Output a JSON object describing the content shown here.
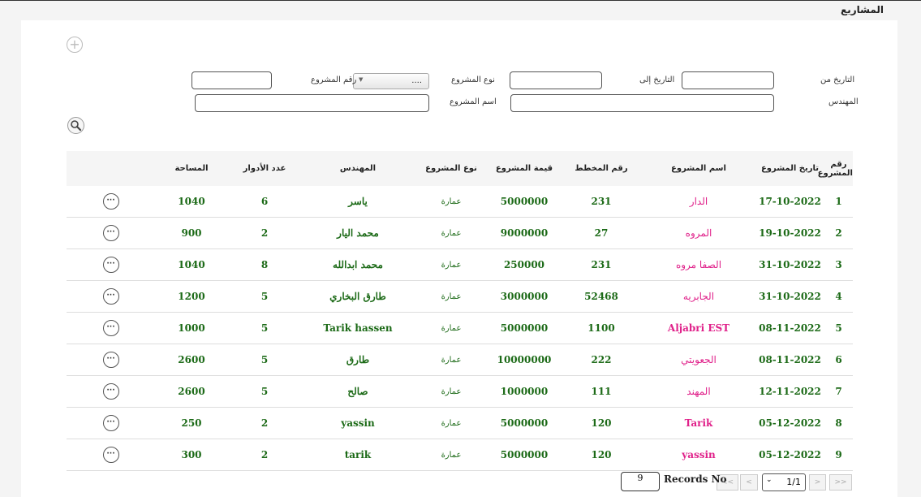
{
  "page_title": "المشاريع",
  "add_icon": "plus-circle-icon",
  "filters": {
    "date_from_label": "التاريخ من",
    "date_to_label": "التاريخ إلى",
    "project_type_label": "نوع المشروع",
    "project_number_label": "رقم المشروع",
    "project_number_value": "....",
    "engineer_label": "المهندس",
    "project_name_label": "اسم المشروع",
    "search_icon": "magnifier-icon"
  },
  "table": {
    "headers": [
      "رقم المشروع",
      "تاريخ المشروع",
      "اسم المشروع",
      "رقم المخطط",
      "قيمة المشروع",
      "نوع المشروع",
      "المهندس",
      "عدد الأدوار",
      "المساحة",
      ""
    ],
    "rows": [
      {
        "no": "1",
        "date": "17-10-2022",
        "name": "الدار",
        "plan": "231",
        "value": "5000000",
        "type": "عمارة",
        "engineer": "ياسر",
        "floors": "6",
        "area": "1040"
      },
      {
        "no": "2",
        "date": "19-10-2022",
        "name": "المروه",
        "plan": "27",
        "value": "9000000",
        "type": "عمارة",
        "engineer": "محمد اليار",
        "floors": "2",
        "area": "900"
      },
      {
        "no": "3",
        "date": "31-10-2022",
        "name": "الصفا مروه",
        "plan": "231",
        "value": "250000",
        "type": "عمارة",
        "engineer": "محمد ابدالله",
        "floors": "8",
        "area": "1040"
      },
      {
        "no": "4",
        "date": "31-10-2022",
        "name": "الجابريه",
        "plan": "52468",
        "value": "3000000",
        "type": "عمارة",
        "engineer": "طارق البخاري",
        "floors": "5",
        "area": "1200"
      },
      {
        "no": "5",
        "date": "08-11-2022",
        "name": "Aljabri EST",
        "plan": "1100",
        "value": "5000000",
        "type": "عمارة",
        "engineer": "Tarik hassen",
        "floors": "5",
        "area": "1000"
      },
      {
        "no": "6",
        "date": "08-11-2022",
        "name": "الجعويتي",
        "plan": "222",
        "value": "10000000",
        "type": "عمارة",
        "engineer": "طارق",
        "floors": "5",
        "area": "2600"
      },
      {
        "no": "7",
        "date": "12-11-2022",
        "name": "المهند",
        "plan": "111",
        "value": "1000000",
        "type": "عمارة",
        "engineer": "صالح",
        "floors": "5",
        "area": "2600"
      },
      {
        "no": "8",
        "date": "05-12-2022",
        "name": "Tarik",
        "plan": "120",
        "value": "5000000",
        "type": "عمارة",
        "engineer": "yassin",
        "floors": "2",
        "area": "250"
      },
      {
        "no": "9",
        "date": "05-12-2022",
        "name": "yassin",
        "plan": "120",
        "value": "5000000",
        "type": "عمارة",
        "engineer": "tarik",
        "floors": "2",
        "area": "300"
      }
    ],
    "row_action_icon": "ellipsis-circle-icon",
    "row_action_label": "···"
  },
  "pagination": {
    "first": ">>",
    "prev": ">",
    "page": "1/1",
    "next": "<",
    "last": "<<",
    "records_label": "Records No",
    "records_value": "9"
  },
  "colors": {
    "data_green": "#1c6a17",
    "name_pink": "#e0218a"
  }
}
